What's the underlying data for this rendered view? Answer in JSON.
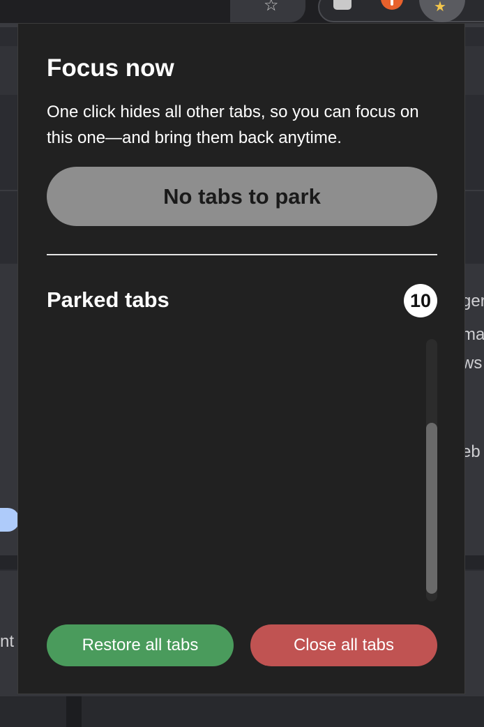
{
  "popup": {
    "title": "Focus now",
    "description": "One click hides all other tabs, so you can focus on this one—and bring them back anytime.",
    "park_button_label": "No tabs to park",
    "parked_section_title": "Parked tabs",
    "parked_count": "10",
    "parked_tabs": [],
    "restore_all_label": "Restore all tabs",
    "close_all_label": "Close all tabs"
  },
  "background": {
    "peek_text": [
      "ger",
      "ma",
      "ws",
      "eb",
      "nt"
    ]
  },
  "colors": {
    "popup_bg": "#212121",
    "park_button_bg": "#8e8e8e",
    "restore_button_bg": "#4a9b5c",
    "close_button_bg": "#c05352",
    "badge_bg": "#ffffff"
  },
  "icons": {
    "toolbar": [
      "star-icon",
      "extension-icon",
      "extension-alert-icon",
      "focus-extension-icon"
    ]
  }
}
